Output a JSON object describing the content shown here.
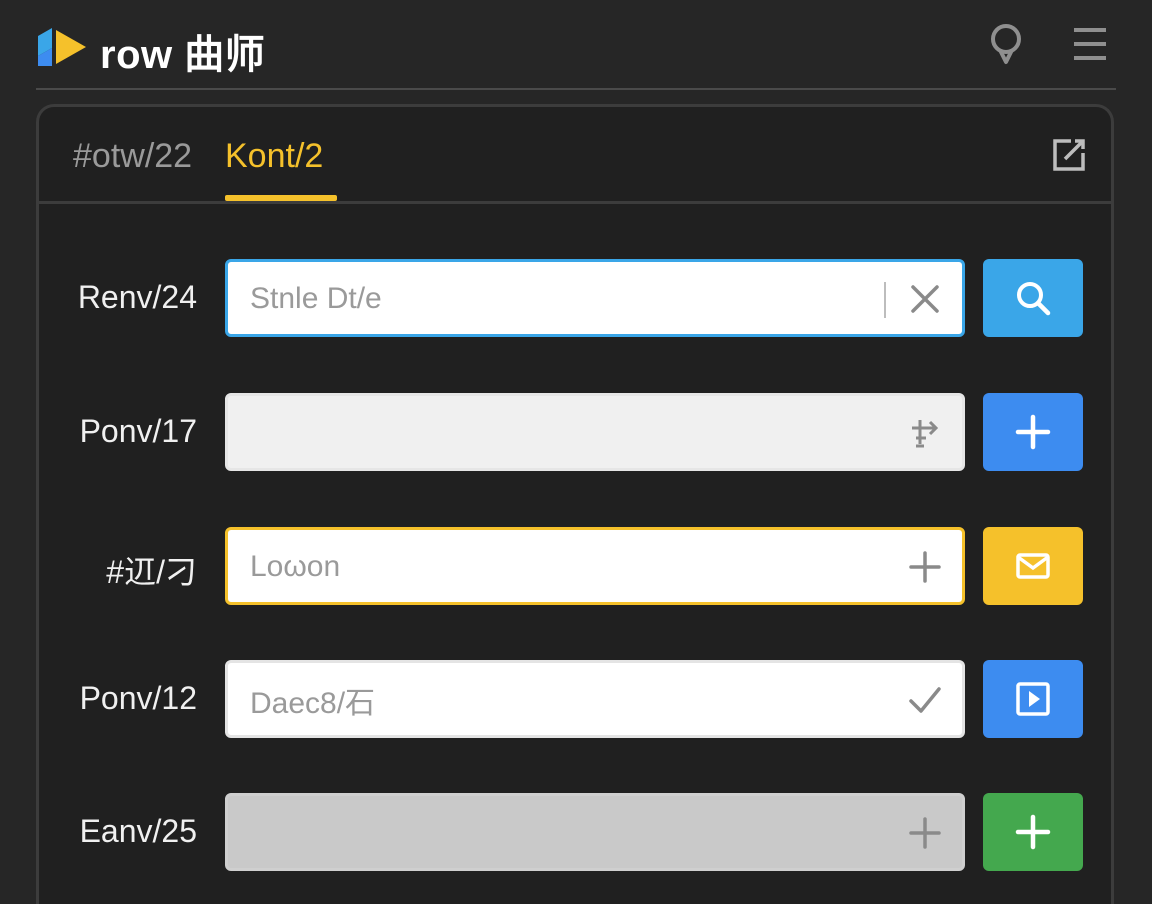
{
  "header": {
    "app_title": "row 曲师",
    "logo_icon": "play-logo-icon",
    "pin_icon": "location-pin-icon",
    "menu_icon": "hamburger-menu-icon"
  },
  "tabs": [
    {
      "label": "#otw/22",
      "active": false
    },
    {
      "label": "Kont/2",
      "active": true
    }
  ],
  "panel": {
    "edit_icon": "external-edit-icon"
  },
  "rows": [
    {
      "label": "Renv/24",
      "value": "Stnle Dt/e",
      "suffix_icon": "clear-x-icon",
      "action_icon": "search-icon",
      "action_color": "#3aa6e8"
    },
    {
      "label": "Ponv/17",
      "value": "",
      "suffix_icon": "transfer-icon",
      "action_icon": "plus-icon",
      "action_color": "#3d8cf0"
    },
    {
      "label": "#䢋/刁",
      "value": "Loωon",
      "suffix_icon": "plus-icon",
      "action_icon": "envelope-icon",
      "action_color": "#f5c12b"
    },
    {
      "label": "Ponv/12",
      "value": "Daec8/石",
      "suffix_icon": "check-icon",
      "action_icon": "play-square-icon",
      "action_color": "#3d8cf0"
    },
    {
      "label": "Eanv/25",
      "value": "",
      "suffix_icon": "plus-icon",
      "action_icon": "plus-icon",
      "action_color": "#44a84e"
    }
  ],
  "colors": {
    "background": "#262626",
    "accent_yellow": "#f5c12b",
    "accent_blue": "#3d8cf0",
    "accent_cyan": "#3aa6e8",
    "accent_green": "#44a84e"
  }
}
